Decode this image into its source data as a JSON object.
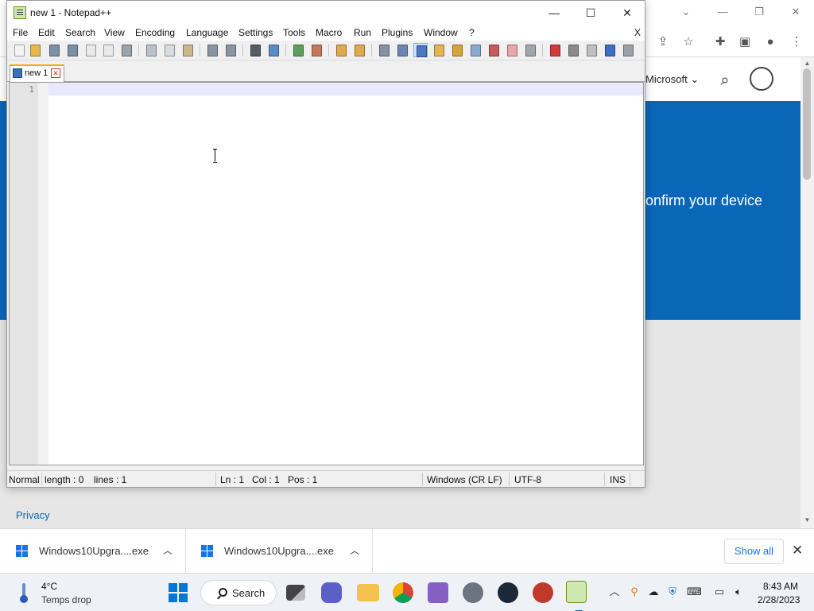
{
  "browser": {
    "header_link": "Microsoft",
    "hero_text": "onfirm your device",
    "footer_link": "Privacy",
    "accent_color": "#0a67b8"
  },
  "notepad": {
    "title": "new 1 - Notepad++",
    "menu": [
      "File",
      "Edit",
      "Search",
      "View",
      "Encoding",
      "Language",
      "Settings",
      "Tools",
      "Macro",
      "Run",
      "Plugins",
      "Window",
      "?"
    ],
    "menu_close": "X",
    "tab_label": "new 1",
    "line_number": "1",
    "status": {
      "mode": "Normal",
      "length": "length : 0",
      "lines": "lines : 1",
      "ln": "Ln : 1",
      "col": "Col : 1",
      "pos": "Pos : 1",
      "eol": "Windows (CR LF)",
      "encoding": "UTF-8",
      "ins": "INS"
    }
  },
  "downloads": {
    "items": [
      {
        "name": "Windows10Upgra....exe"
      },
      {
        "name": "Windows10Upgra....exe"
      }
    ],
    "show_all": "Show all"
  },
  "taskbar": {
    "weather_temp": "4°C",
    "weather_cond": "Temps drop",
    "search_label": "Search",
    "time": "8:43 AM",
    "date": "2/28/2023"
  }
}
